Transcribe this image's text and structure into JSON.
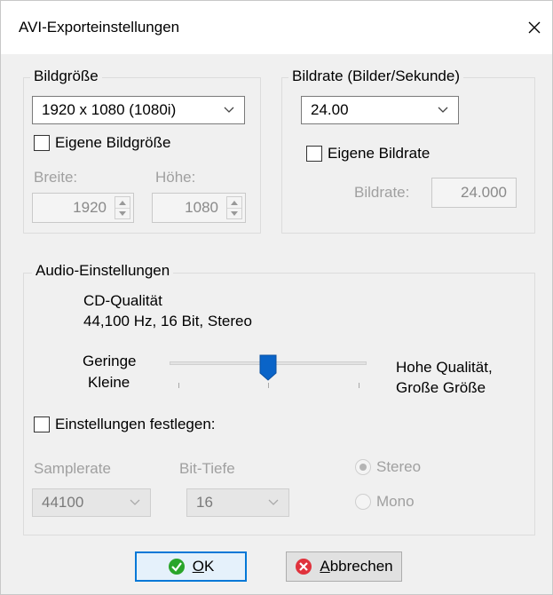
{
  "window": {
    "title": "AVI-Exporteinstellungen",
    "close_icon": "close-icon"
  },
  "frame_size": {
    "legend": "Bildgröße",
    "preset_value": "1920 x 1080 (1080i)",
    "custom_checkbox_label": "Eigene Bildgröße",
    "custom_checked": false,
    "width_label": "Breite:",
    "width_value": "1920",
    "height_label": "Höhe:",
    "height_value": "1080"
  },
  "frame_rate": {
    "legend": "Bildrate (Bilder/Sekunde)",
    "preset_value": "24.00",
    "custom_checkbox_label": "Eigene Bildrate",
    "custom_checked": false,
    "rate_label": "Bildrate:",
    "rate_value": "24.000"
  },
  "audio": {
    "legend": "Audio-Einstellungen",
    "quality_name": "CD-Qualität",
    "quality_detail": "44,100 Hz, 16 Bit, Stereo",
    "left_label_line1": "Geringe",
    "left_label_line2": "Kleine",
    "right_label_line1": "Hohe Qualität,",
    "right_label_line2": "Große Größe",
    "slider_fraction": 0.5,
    "define_checkbox_label": "Einstellungen festlegen:",
    "define_checked": false,
    "samplerate_label": "Samplerate",
    "samplerate_value": "44100",
    "bitdepth_label": "Bit-Tiefe",
    "bitdepth_value": "16",
    "channel_options": [
      "Stereo",
      "Mono"
    ],
    "channel_selected": "Stereo"
  },
  "buttons": {
    "ok_label": "OK",
    "ok_mnemonic": "O",
    "ok_rest": "K",
    "cancel_mnemonic": "A",
    "cancel_rest": "bbrechen"
  },
  "colors": {
    "accent": "#0078d7",
    "slider_thumb": "#0a64c8",
    "ok_icon": "#2aa52a",
    "cancel_icon": "#e0323c"
  }
}
